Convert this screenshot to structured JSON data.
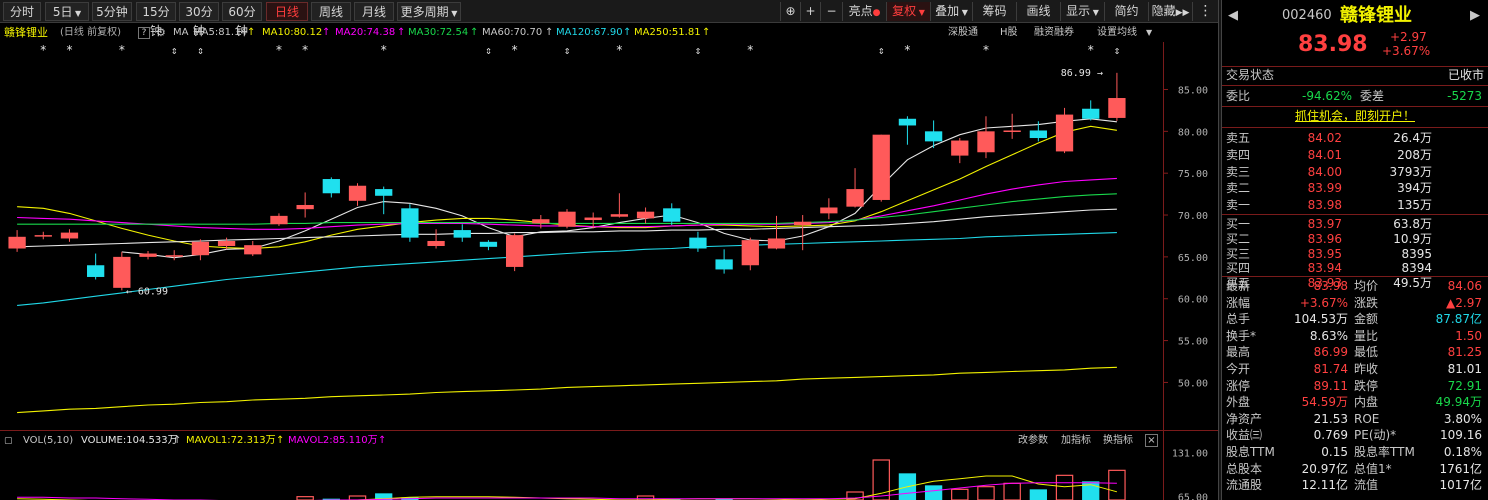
{
  "toolbar": {
    "periods": [
      "分时",
      "5日",
      "5分钟",
      "15分钟",
      "30分钟",
      "60分钟",
      "日线",
      "周线",
      "月线",
      "更多周期"
    ],
    "active_period": "日线",
    "tools": [
      "⊕",
      "+",
      "−",
      "亮点",
      "复权",
      "叠加",
      "筹码",
      "画线",
      "显示",
      "简约",
      "隐藏"
    ]
  },
  "legend": {
    "stock": "赣锋锂业",
    "mode": "(日线 前复权)",
    "help": "?",
    "ma_label": "MA",
    "ma": [
      {
        "text": "MA5:81.14",
        "color": "#e6e6e6"
      },
      {
        "text": "MA10:80.12",
        "color": "#f2f200"
      },
      {
        "text": "MA20:74.38",
        "color": "#ff00ff"
      },
      {
        "text": "MA30:72.54",
        "color": "#19d84b"
      },
      {
        "text": "MA60:70.70",
        "color": "#e6e6e6"
      },
      {
        "text": "MA120:67.90",
        "color": "#20d8e8"
      },
      {
        "text": "MA250:51.81",
        "color": "#f2f200"
      }
    ],
    "links": [
      "深股通",
      "H股",
      "融资融券",
      "设置均线"
    ]
  },
  "vol_legend": {
    "label": "VOL(5,10)",
    "volume": "VOLUME:104.533万",
    "mavol1": "MAVOL1:72.313万",
    "mavol2": "MAVOL2:85.110万",
    "links": [
      "改参数",
      "加指标",
      "换指标",
      "×"
    ]
  },
  "chart_data": {
    "type": "candlestick",
    "ylim": [
      45.75,
      89.0
    ],
    "yticks": [
      50.0,
      55.0,
      60.0,
      65.0,
      70.0,
      75.0,
      80.0,
      85.0
    ],
    "high_label": "86.99",
    "low_label": "60.99",
    "candles": [
      {
        "o": 66.0,
        "c": 67.4,
        "h": 68.2,
        "l": 65.6
      },
      {
        "o": 67.5,
        "c": 67.6,
        "h": 68.0,
        "l": 67.1
      },
      {
        "o": 67.2,
        "c": 67.9,
        "h": 68.3,
        "l": 66.8
      },
      {
        "o": 64.0,
        "c": 62.6,
        "h": 65.4,
        "l": 62.3
      },
      {
        "o": 61.3,
        "c": 65.0,
        "h": 65.6,
        "l": 61.0
      },
      {
        "o": 65.0,
        "c": 65.4,
        "h": 65.7,
        "l": 64.7
      },
      {
        "o": 65.2,
        "c": 65.2,
        "h": 65.8,
        "l": 64.6
      },
      {
        "o": 65.2,
        "c": 66.8,
        "h": 67.1,
        "l": 64.6
      },
      {
        "o": 66.3,
        "c": 66.9,
        "h": 67.3,
        "l": 65.9
      },
      {
        "o": 65.3,
        "c": 66.4,
        "h": 66.9,
        "l": 65.1
      },
      {
        "o": 68.9,
        "c": 69.9,
        "h": 70.2,
        "l": 68.7
      },
      {
        "o": 70.7,
        "c": 71.2,
        "h": 72.7,
        "l": 69.7
      },
      {
        "o": 74.3,
        "c": 72.6,
        "h": 74.5,
        "l": 72.1
      },
      {
        "o": 71.7,
        "c": 73.5,
        "h": 73.8,
        "l": 71.1
      },
      {
        "o": 73.1,
        "c": 72.3,
        "h": 73.4,
        "l": 70.1
      },
      {
        "o": 70.8,
        "c": 67.3,
        "h": 71.3,
        "l": 66.8
      },
      {
        "o": 66.3,
        "c": 66.9,
        "h": 68.3,
        "l": 66.0
      },
      {
        "o": 68.2,
        "c": 67.3,
        "h": 68.9,
        "l": 66.8
      },
      {
        "o": 66.8,
        "c": 66.2,
        "h": 67.0,
        "l": 65.8
      },
      {
        "o": 63.8,
        "c": 67.6,
        "h": 67.8,
        "l": 63.3
      },
      {
        "o": 69.0,
        "c": 69.5,
        "h": 70.0,
        "l": 68.4
      },
      {
        "o": 68.6,
        "c": 70.4,
        "h": 70.7,
        "l": 68.4
      },
      {
        "o": 69.4,
        "c": 69.7,
        "h": 70.3,
        "l": 68.4
      },
      {
        "o": 69.8,
        "c": 70.1,
        "h": 72.6,
        "l": 69.7
      },
      {
        "o": 69.6,
        "c": 70.4,
        "h": 70.9,
        "l": 69.0
      },
      {
        "o": 70.8,
        "c": 69.2,
        "h": 71.4,
        "l": 68.8
      },
      {
        "o": 67.3,
        "c": 66.0,
        "h": 68.0,
        "l": 65.6
      },
      {
        "o": 64.7,
        "c": 63.5,
        "h": 65.9,
        "l": 63.0
      },
      {
        "o": 64.0,
        "c": 67.0,
        "h": 67.3,
        "l": 63.4
      },
      {
        "o": 66.0,
        "c": 67.2,
        "h": 69.9,
        "l": 65.9
      },
      {
        "o": 68.8,
        "c": 69.2,
        "h": 70.0,
        "l": 65.8
      },
      {
        "o": 70.2,
        "c": 70.9,
        "h": 72.0,
        "l": 69.5
      },
      {
        "o": 71.0,
        "c": 73.1,
        "h": 75.6,
        "l": 70.9
      },
      {
        "o": 71.8,
        "c": 79.6,
        "h": 79.6,
        "l": 71.6
      },
      {
        "o": 81.5,
        "c": 80.7,
        "h": 81.8,
        "l": 78.4
      },
      {
        "o": 80.0,
        "c": 78.8,
        "h": 81.3,
        "l": 78.0
      },
      {
        "o": 77.1,
        "c": 78.9,
        "h": 79.2,
        "l": 76.2
      },
      {
        "o": 77.5,
        "c": 80.0,
        "h": 81.8,
        "l": 76.8
      },
      {
        "o": 80.0,
        "c": 80.1,
        "h": 82.1,
        "l": 79.1
      },
      {
        "o": 80.1,
        "c": 79.2,
        "h": 81.2,
        "l": 78.8
      },
      {
        "o": 77.6,
        "c": 82.0,
        "h": 82.8,
        "l": 77.4
      },
      {
        "o": 82.7,
        "c": 81.5,
        "h": 83.7,
        "l": 81.3
      },
      {
        "o": 81.6,
        "c": 83.98,
        "h": 86.99,
        "l": 81.25
      }
    ],
    "ma": [
      {
        "name": "MA5",
        "color": "#e6e6e6",
        "values": [
          null,
          null,
          null,
          null,
          65.6,
          65.3,
          64.9,
          65.3,
          65.9,
          66.0,
          66.9,
          68.1,
          69.5,
          70.9,
          71.6,
          71.4,
          70.8,
          69.9,
          68.5,
          67.4,
          68.0,
          68.1,
          68.5,
          69.1,
          69.6,
          70.0,
          69.1,
          67.8,
          67.0,
          66.9,
          67.5,
          68.6,
          70.2,
          73.5,
          76.6,
          78.3,
          79.6,
          80.4,
          80.6,
          80.8,
          81.2,
          81.5,
          81.14
        ]
      },
      {
        "name": "MA10",
        "color": "#f2f200",
        "values": [
          71.0,
          70.8,
          70.2,
          69.3,
          68.4,
          67.6,
          66.9,
          66.3,
          66.1,
          66.0,
          66.2,
          66.8,
          67.6,
          68.3,
          68.7,
          69.1,
          69.4,
          69.6,
          69.6,
          69.4,
          69.1,
          68.8,
          68.6,
          68.5,
          68.5,
          68.7,
          68.8,
          68.8,
          68.7,
          68.6,
          68.7,
          68.8,
          69.3,
          70.4,
          71.7,
          73.0,
          74.3,
          75.8,
          77.2,
          78.6,
          79.9,
          80.6,
          80.12
        ]
      },
      {
        "name": "MA20",
        "color": "#ff00ff",
        "values": [
          69.7,
          69.6,
          69.5,
          69.3,
          69.1,
          68.9,
          68.7,
          68.5,
          68.4,
          68.3,
          68.3,
          68.4,
          68.6,
          68.8,
          68.9,
          69.0,
          69.0,
          69.0,
          68.9,
          68.8,
          68.7,
          68.7,
          68.6,
          68.6,
          68.6,
          68.7,
          68.8,
          68.9,
          68.9,
          68.9,
          69.0,
          69.1,
          69.4,
          69.9,
          70.5,
          71.1,
          71.8,
          72.5,
          73.1,
          73.6,
          74.0,
          74.2,
          74.38
        ]
      },
      {
        "name": "MA30",
        "color": "#19d84b",
        "values": [
          68.9,
          68.9,
          68.9,
          68.9,
          68.9,
          68.9,
          68.9,
          68.9,
          68.9,
          68.9,
          69.0,
          69.0,
          69.1,
          69.1,
          69.1,
          69.1,
          69.1,
          69.1,
          69.1,
          69.1,
          69.0,
          69.0,
          69.0,
          69.0,
          69.0,
          69.0,
          69.0,
          69.0,
          69.0,
          69.0,
          69.1,
          69.2,
          69.4,
          69.7,
          70.0,
          70.4,
          70.8,
          71.2,
          71.6,
          71.9,
          72.2,
          72.4,
          72.54
        ]
      },
      {
        "name": "MA60",
        "color": "#e6e6e6",
        "values": [
          66.2,
          66.3,
          66.4,
          66.5,
          66.6,
          66.7,
          66.8,
          66.9,
          67.0,
          67.1,
          67.2,
          67.3,
          67.4,
          67.5,
          67.6,
          67.7,
          67.7,
          67.8,
          67.8,
          67.9,
          67.9,
          68.0,
          68.0,
          68.1,
          68.1,
          68.2,
          68.2,
          68.3,
          68.3,
          68.4,
          68.5,
          68.6,
          68.7,
          68.8,
          69.0,
          69.2,
          69.5,
          69.8,
          70.0,
          70.2,
          70.4,
          70.6,
          70.7
        ]
      },
      {
        "name": "MA120",
        "color": "#20d8e8",
        "values": [
          59.2,
          59.5,
          59.9,
          60.3,
          60.7,
          61.1,
          61.5,
          61.9,
          62.3,
          62.6,
          62.9,
          63.2,
          63.5,
          63.8,
          64.0,
          64.2,
          64.4,
          64.6,
          64.8,
          65.0,
          65.2,
          65.4,
          65.6,
          65.7,
          65.9,
          66.0,
          66.2,
          66.3,
          66.4,
          66.5,
          66.6,
          66.7,
          66.8,
          66.9,
          67.0,
          67.1,
          67.2,
          67.4,
          67.5,
          67.6,
          67.7,
          67.8,
          67.9
        ]
      },
      {
        "name": "MA250",
        "color": "#f2f200",
        "values": [
          46.4,
          46.6,
          46.8,
          46.9,
          47.1,
          47.3,
          47.4,
          47.6,
          47.7,
          47.9,
          48.0,
          48.1,
          48.3,
          48.4,
          48.5,
          48.6,
          48.8,
          48.9,
          49.0,
          49.1,
          49.2,
          49.4,
          49.5,
          49.6,
          49.7,
          49.8,
          49.9,
          50.0,
          50.1,
          50.2,
          50.4,
          50.5,
          50.6,
          50.7,
          50.8,
          50.9,
          51.1,
          51.2,
          51.3,
          51.4,
          51.5,
          51.7,
          51.81
        ]
      }
    ],
    "volume": {
      "ylim": [
        60.0,
        135.0
      ],
      "yticks": [
        65.0,
        131.0
      ],
      "values": [
        58,
        55,
        52,
        60,
        56,
        54,
        55,
        57,
        59,
        52,
        60,
        65,
        62,
        66,
        70,
        64,
        57,
        55,
        55,
        58,
        56,
        57,
        55,
        60,
        66,
        62,
        58,
        62,
        57,
        55,
        58,
        60,
        72,
        120,
        100,
        82,
        76,
        80,
        85,
        76,
        97,
        88,
        104.5
      ],
      "mavol": [
        {
          "name": "MAVOL1",
          "color": "#f2f200",
          "values": [
            62,
            61,
            60,
            59,
            58,
            57,
            56,
            56,
            56,
            56,
            56,
            57,
            58,
            60,
            62,
            64,
            65,
            65,
            65,
            64,
            63,
            62,
            61,
            60,
            60,
            61,
            62,
            62,
            62,
            61,
            60,
            61,
            62,
            70,
            80,
            88,
            92,
            96,
            96,
            84,
            80,
            83,
            72.313
          ]
        },
        {
          "name": "MAVOL2",
          "color": "#ff00ff",
          "values": [
            64,
            64,
            63,
            63,
            62,
            61,
            60,
            60,
            59,
            59,
            59,
            59,
            60,
            60,
            61,
            62,
            63,
            63,
            63,
            63,
            63,
            63,
            63,
            62,
            62,
            62,
            62,
            62,
            62,
            62,
            62,
            62,
            63,
            66,
            70,
            74,
            78,
            82,
            85,
            86,
            86,
            86,
            85.11
          ]
        }
      ]
    },
    "markers_star": [
      1,
      2,
      4,
      10,
      11,
      14,
      19,
      23,
      28,
      34,
      37,
      41
    ],
    "markers_updown": [
      6,
      7,
      18,
      21,
      26,
      33,
      42
    ]
  },
  "quote": {
    "code": "002460",
    "name": "赣锋锂业",
    "price": "83.98",
    "change": "+2.97",
    "change_pct": "+3.67%",
    "status_label": "交易状态",
    "status": "已收市",
    "weibi_label": "委比",
    "weibi": "-94.62%",
    "weicha_label": "委差",
    "weicha": "-5273",
    "promo": "抓住机会，即刻开户！",
    "asks": [
      {
        "label": "卖五",
        "price": "84.02",
        "vol": "26.4万"
      },
      {
        "label": "卖四",
        "price": "84.01",
        "vol": "208万"
      },
      {
        "label": "卖三",
        "price": "84.00",
        "vol": "3793万"
      },
      {
        "label": "卖二",
        "price": "83.99",
        "vol": "394万"
      },
      {
        "label": "卖一",
        "price": "83.98",
        "vol": "135万"
      }
    ],
    "bids": [
      {
        "label": "买一",
        "price": "83.97",
        "vol": "63.8万"
      },
      {
        "label": "买二",
        "price": "83.96",
        "vol": "10.9万"
      },
      {
        "label": "买三",
        "price": "83.95",
        "vol": "8395"
      },
      {
        "label": "买四",
        "price": "83.94",
        "vol": "8394"
      },
      {
        "label": "买五",
        "price": "83.93",
        "vol": "49.5万"
      }
    ],
    "stats": [
      {
        "l1": "最新",
        "v1": "83.98",
        "c1": "red",
        "l2": "均价",
        "v2": "84.06",
        "c2": "red"
      },
      {
        "l1": "涨幅",
        "v1": "+3.67%",
        "c1": "red",
        "l2": "涨跌",
        "v2": "▲2.97",
        "c2": "red"
      },
      {
        "l1": "总手",
        "v1": "104.53万",
        "c1": "white",
        "l2": "金额",
        "v2": "87.87亿",
        "c2": "cyan"
      },
      {
        "l1": "换手*",
        "v1": "8.63%",
        "c1": "white",
        "l2": "量比",
        "v2": "1.50",
        "c2": "red"
      },
      {
        "l1": "最高",
        "v1": "86.99",
        "c1": "red",
        "l2": "最低",
        "v2": "81.25",
        "c2": "red"
      },
      {
        "l1": "今开",
        "v1": "81.74",
        "c1": "red",
        "l2": "昨收",
        "v2": "81.01",
        "c2": "white"
      },
      {
        "l1": "涨停",
        "v1": "89.11",
        "c1": "red",
        "l2": "跌停",
        "v2": "72.91",
        "c2": "green"
      },
      {
        "l1": "外盘",
        "v1": "54.59万",
        "c1": "red",
        "l2": "内盘",
        "v2": "49.94万",
        "c2": "green"
      },
      {
        "l1": "净资产",
        "v1": "21.53",
        "c1": "white",
        "l2": "ROE",
        "v2": "3.80%",
        "c2": "white"
      },
      {
        "l1": "收益㈢",
        "v1": "0.769",
        "c1": "white",
        "l2": "PE(动)*",
        "v2": "109.16",
        "c2": "white"
      },
      {
        "l1": "股息TTM",
        "v1": "0.15",
        "c1": "white",
        "l2": "股息率TTM",
        "v2": "0.18%",
        "c2": "white"
      },
      {
        "l1": "总股本",
        "v1": "20.97亿",
        "c1": "white",
        "l2": "总值1*",
        "v2": "1761亿",
        "c2": "white"
      },
      {
        "l1": "流通股",
        "v1": "12.11亿",
        "c1": "white",
        "l2": "流值",
        "v2": "1017亿",
        "c2": "white"
      }
    ]
  }
}
